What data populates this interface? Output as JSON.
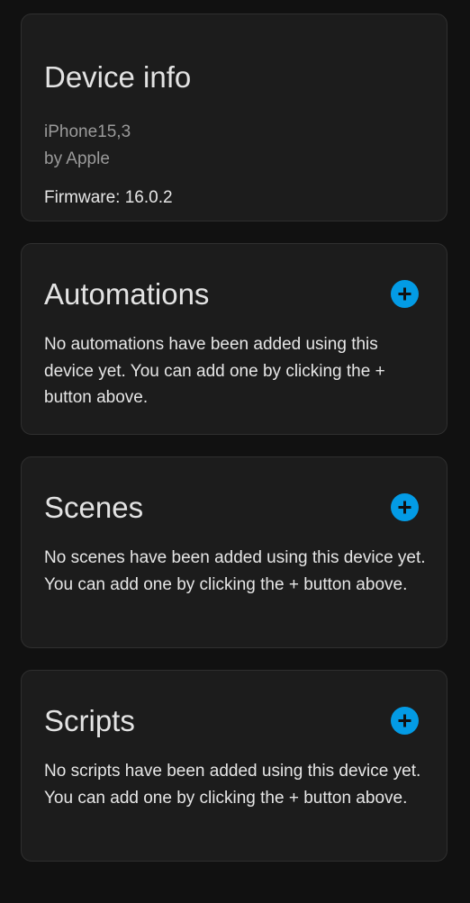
{
  "device_info": {
    "title": "Device info",
    "model": "iPhone15,3",
    "manufacturer": "by Apple",
    "firmware": "Firmware: 16.0.2"
  },
  "automations": {
    "title": "Automations",
    "add_icon": "plus-circle-icon",
    "empty_text": "No automations have been added using this device yet. You can add one by clicking the + button above."
  },
  "scenes": {
    "title": "Scenes",
    "add_icon": "plus-circle-icon",
    "empty_text": "No scenes have been added using this device yet. You can add one by clicking the + button above."
  },
  "scripts": {
    "title": "Scripts",
    "add_icon": "plus-circle-icon",
    "empty_text": "No scripts have been added using this device yet. You can add one by clicking the + button above."
  },
  "colors": {
    "background": "#111111",
    "card": "#1c1c1c",
    "accent": "#039be5"
  }
}
